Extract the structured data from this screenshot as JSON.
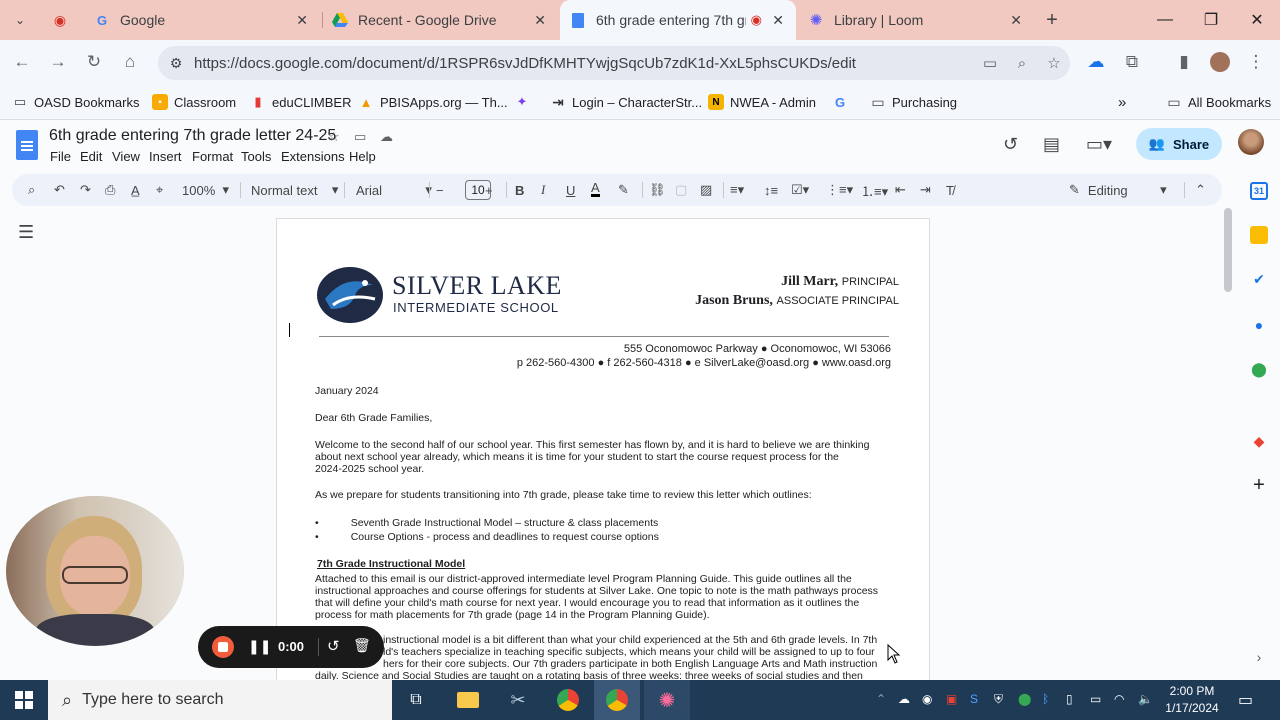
{
  "browser": {
    "tabs": [
      {
        "label": "Google"
      },
      {
        "label": "Recent - Google Drive"
      },
      {
        "label": "6th grade entering 7th grad"
      },
      {
        "label": "Library | Loom"
      }
    ],
    "url": "https://docs.google.com/document/d/1RSPR6svJdDfKMHTYwjgSqcUb7zdK1d-XxL5phsCUKDs/edit",
    "bookmarks": [
      {
        "label": "OASD Bookmarks"
      },
      {
        "label": "Classroom"
      },
      {
        "label": "eduCLIMBER"
      },
      {
        "label": "PBISApps.org — Th..."
      },
      {
        "label": "Login – CharacterStr..."
      },
      {
        "label": "NWEA - Admin"
      },
      {
        "label": "Purchasing"
      }
    ],
    "all_bookmarks": "All Bookmarks"
  },
  "docs": {
    "title": "6th grade entering 7th grade letter 24-25",
    "menu": [
      "File",
      "Edit",
      "View",
      "Insert",
      "Format",
      "Tools",
      "Extensions",
      "Help"
    ],
    "share_label": "Share",
    "toolbar": {
      "zoom": "100%",
      "style": "Normal text",
      "font": "Arial",
      "font_size": "10",
      "mode": "Editing"
    }
  },
  "letter": {
    "school_line1": "SILVER LAKE",
    "school_line2": "INTERMEDIATE SCHOOL",
    "principal_name": "Jill Marr,",
    "principal_title": "PRINCIPAL",
    "assoc_name": "Jason Bruns,",
    "assoc_title": "ASSOCIATE PRINCIPAL",
    "address": "555 Oconomowoc Parkway ●  Oconomowoc, WI 53066",
    "contact": "p 262-560-4300 ●  f 262-560-4318 ●  e SilverLake@oasd.org ●  www.oasd.org",
    "date": "January 2024",
    "salutation": "Dear 6th Grade Families,",
    "para1_l1": "Welcome to the second half of our school year.  This first semester has flown by, and it is hard to believe we are thinking",
    "para1_l2": "about next school year already, which means it is time for your student to start the course request process for the",
    "para1_l3": "2024-2025 school year.",
    "para2": "As we prepare for students transitioning into 7th grade, please take time to review this letter which outlines:",
    "bullet1": "Seventh Grade Instructional Model – structure & class placements",
    "bullet2": "Course Options - process and deadlines to request course options",
    "heading1": "7th Grade Instructional Model",
    "para3_l1": "Attached to this email is our district-approved intermediate level Program Planning Guide. This guide outlines all the",
    "para3_l2": "instructional approaches and course offerings for students at Silver Lake. One topic to note is the math pathways process",
    "para3_l3": "that will define your child's math course for next year. I would encourage you to read that information as it outlines the",
    "para3_l4": "process for math placements for 7th grade (page 14 in the Program Planning Guide).",
    "para4_l1": "instructional model is a bit different than what your child experienced at the 5th and 6th grade levels. In 7th",
    "para4_l2": "ld's teachers specialize in teaching specific subjects, which means your child will be assigned to up to four",
    "para4_l3": "hers for their core subjects. Our 7th graders participate in both English Language Arts and Math instruction",
    "para4_l4": "daily. Science and Social Studies are taught on a rotating basis of three weeks: three weeks of social studies and then"
  },
  "loom": {
    "timer": "0:00"
  },
  "taskbar": {
    "search_placeholder": "Type here to search",
    "time": "2:00 PM",
    "date": "1/17/2024"
  },
  "colors": {
    "tabstrip": "#f2c9c0",
    "docs_blue": "#4285f4",
    "share_bg": "#c2e7ff",
    "loom_record": "#f25c3b"
  }
}
